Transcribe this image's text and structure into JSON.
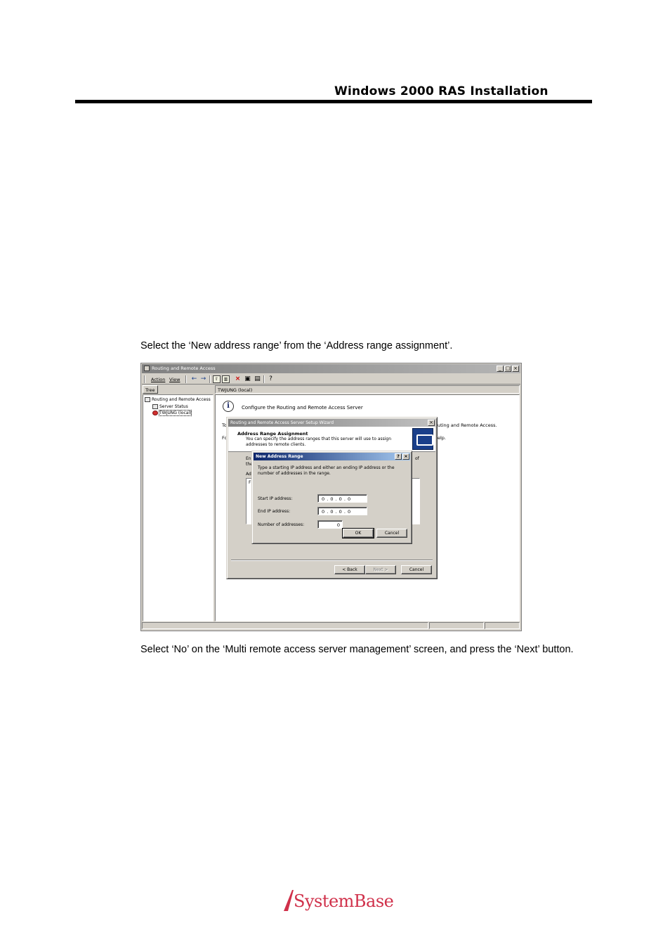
{
  "header": {
    "title": "Windows 2000 RAS Installation"
  },
  "paragraphs": {
    "p1": "Select the ‘New address range’ from the ‘Address range assignment’.",
    "p2": "Select ‘No’ on the ‘Multi remote access server management’ screen, and press the ‘Next’ button."
  },
  "screenshot": {
    "window_title": "Routing and Remote Access",
    "menu": {
      "action": "Action",
      "view": "View"
    },
    "tree_tab": "Tree",
    "right_header": "TWJUNG (local)",
    "tree": {
      "root": "Routing and Remote Access",
      "server_status": "Server Status",
      "server": "TWJUNG (local)"
    },
    "content": {
      "title": "Configure the Routing and Remote Access Server",
      "frag_to": "To",
      "frag_fo": "Fo",
      "frag_right1": "uting and Remote Access.",
      "frag_right2": "elp."
    },
    "wizard": {
      "title": "Routing and Remote Access Server Setup Wizard",
      "heading": "Address Range Assignment",
      "subheading": "You can specify the address ranges that this server will use to assign addresses to remote clients.",
      "frag_en": "En",
      "frag_the": "the",
      "frag_ad": "Ad",
      "frag_f": "F",
      "frag_of": "of",
      "back": "< Back",
      "next": "Next >",
      "cancel": "Cancel"
    },
    "new_range": {
      "title": "New Address Range",
      "help_btn": "?",
      "close_btn": "×",
      "description": "Type a starting IP address and either an ending IP address or the number of addresses in the range.",
      "start_label": "Start IP address:",
      "start_value": "0 . 0 . 0 . 0",
      "end_label": "End IP address:",
      "end_value": "0 . 0 . 0 . 0",
      "count_label": "Number of addresses:",
      "count_value": "0",
      "ok": "OK",
      "cancel": "Cancel"
    }
  },
  "logo": {
    "text": "SystemBase"
  }
}
